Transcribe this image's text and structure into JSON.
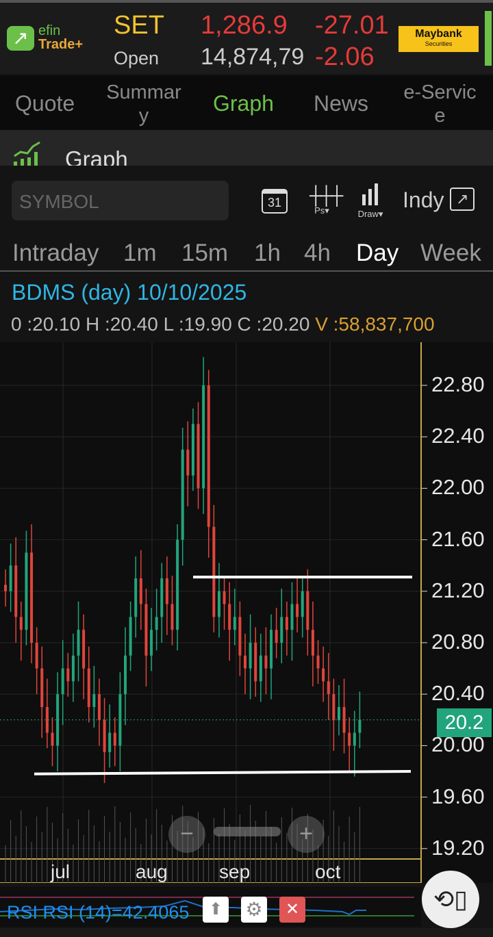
{
  "header": {
    "logo_line1": "efin",
    "logo_line2": "Trade+",
    "index_name": "SET",
    "index_value": "1,286.9",
    "index_change": "-27.01",
    "status": "Open",
    "volume": "14,874,79",
    "pct_change": "-2.06",
    "broker_name": "Maybank",
    "broker_sub": "Securities"
  },
  "tabs": [
    {
      "label": "Quote"
    },
    {
      "label": "Summar\ny"
    },
    {
      "label": "Graph"
    },
    {
      "label": "News"
    },
    {
      "label": "e-Servic\ne"
    }
  ],
  "section_title": "Graph",
  "toolbar": {
    "symbol_placeholder": "SYMBOL",
    "calendar_day": "31",
    "ps_label": "Ps▾",
    "draw_label": "Draw▾",
    "indy_label": "Indy"
  },
  "timeframes": [
    {
      "label": "Intraday"
    },
    {
      "label": "1m"
    },
    {
      "label": "15m"
    },
    {
      "label": "1h"
    },
    {
      "label": "4h"
    },
    {
      "label": "Day"
    },
    {
      "label": "Week"
    }
  ],
  "info": {
    "title": "BDMS (day) 10/10/2025",
    "ohlc": "0 :20.10 H :20.40 L :19.90 C :20.20",
    "volume": "V :58,837,700"
  },
  "chart_data": {
    "type": "candlestick",
    "ylim": [
      19.0,
      23.0
    ],
    "y_ticks": [
      "22.80",
      "22.40",
      "22.00",
      "21.60",
      "21.20",
      "20.80",
      "20.40",
      "20.00",
      "19.60",
      "19.20"
    ],
    "x_labels": [
      "jul",
      "aug",
      "sep",
      "oct"
    ],
    "last_price_label": "20.2",
    "close": [
      21.2,
      21.4,
      21.0,
      20.9,
      21.5,
      20.8,
      20.6,
      20.3,
      20.1,
      20.0,
      20.4,
      20.6,
      20.5,
      20.7,
      20.9,
      20.6,
      20.3,
      20.4,
      20.2,
      19.95,
      20.1,
      20.0,
      20.4,
      20.7,
      21.0,
      21.3,
      21.1,
      20.7,
      20.9,
      21.0,
      21.3,
      21.1,
      20.9,
      21.6,
      22.3,
      22.1,
      22.5,
      22.0,
      22.8,
      21.7,
      21.0,
      21.2,
      21.1,
      20.9,
      21.0,
      20.7,
      20.6,
      20.8,
      20.5,
      20.7,
      20.6,
      20.9,
      20.8,
      21.0,
      20.9,
      21.1,
      21.0,
      21.2,
      20.9,
      20.7,
      20.6,
      20.5,
      20.4,
      20.2,
      20.3,
      20.1,
      20.0,
      20.1,
      20.2
    ],
    "resistance": 21.31,
    "support": [
      19.78,
      19.8
    ]
  },
  "rsi": {
    "label": "RSI RSI (14)=42.4065"
  },
  "colors": {
    "up": "#22a57c",
    "down": "#e0453c",
    "neutral": "#d4a72c",
    "accent": "#6cc04a"
  }
}
